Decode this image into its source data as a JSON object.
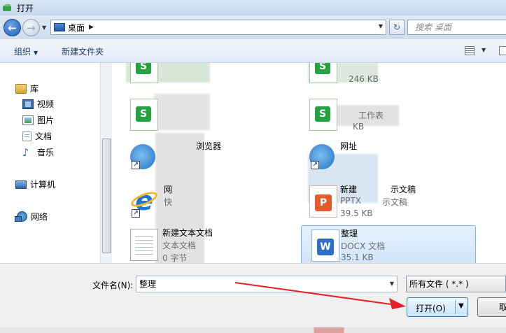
{
  "window": {
    "title": "打开"
  },
  "address_bar": {
    "crumb": "桌面",
    "search_placeholder": "搜索 桌面"
  },
  "toolbar": {
    "organize": "组织",
    "new_folder": "新建文件夹"
  },
  "nav": {
    "library": "库",
    "video": "视频",
    "pictures": "图片",
    "documents": "文档",
    "music": "音乐",
    "computer": "计算机",
    "network": "网络"
  },
  "files": {
    "f1": {
      "size": "246 KB"
    },
    "f2": {
      "type_partial": "工作表",
      "size_partial": "KB"
    },
    "f3": {
      "name_partial": "浏览器"
    },
    "f4": {
      "name_partial": "网址"
    },
    "f5": {
      "name_partial_a": "网",
      "name_partial_b": "快"
    },
    "f6": {
      "name_partial": "新建",
      "name_suffix": "示文稿",
      "type": "PPTX",
      "type_suffix": "示文稿",
      "size": "39.5 KB"
    },
    "f7": {
      "name": "新建文本文档",
      "type": "文本文档",
      "size": "0 字节"
    },
    "f8": {
      "name": "整理",
      "type": "DOCX 文档",
      "size": "35.1 KB"
    }
  },
  "bottom": {
    "filename_label": "文件名(N):",
    "filename_value": "整理",
    "filetype_value": "所有文件 ( *.* )",
    "open_label": "打开(O)",
    "cancel_label": "取消"
  },
  "colors": {
    "accent": "#3c7fb1",
    "arrow": "#e8202a",
    "selection": "#cfe5fa"
  }
}
